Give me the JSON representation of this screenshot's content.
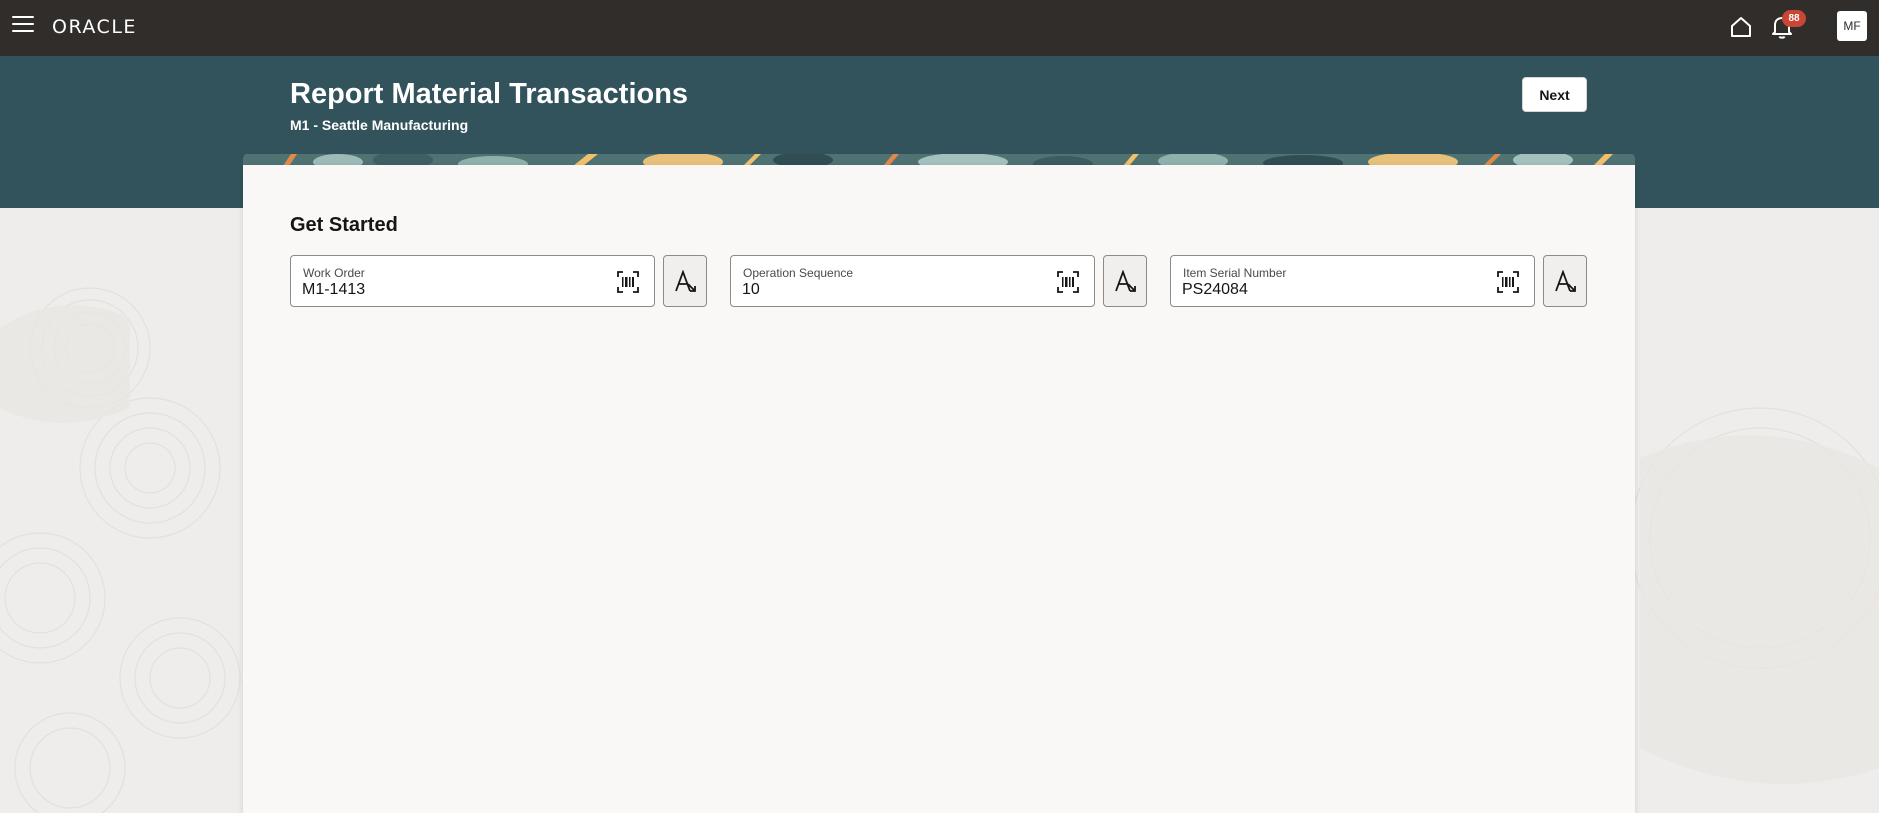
{
  "topbar": {
    "logo": "ORACLE",
    "notifications_count": "88",
    "avatar_initials": "MF"
  },
  "header": {
    "title": "Report Material Transactions",
    "subtitle": "M1 - Seattle Manufacturing",
    "next_label": "Next"
  },
  "main": {
    "section_title": "Get Started",
    "fields": [
      {
        "label": "Work Order",
        "value": "M1-1413"
      },
      {
        "label": "Operation Sequence",
        "value": "10"
      },
      {
        "label": "Item Serial Number",
        "value": "PS24084"
      }
    ]
  },
  "icons": {
    "menu": "hamburger-icon",
    "home": "home-icon",
    "notifications": "bell-icon",
    "scan": "barcode-scan-icon",
    "text_input": "text-input-icon"
  },
  "colors": {
    "topbar": "#312d2a",
    "hero": "#33535c",
    "badge": "#c74634",
    "card": "#f9f8f6",
    "page_bg": "#efedeb"
  }
}
